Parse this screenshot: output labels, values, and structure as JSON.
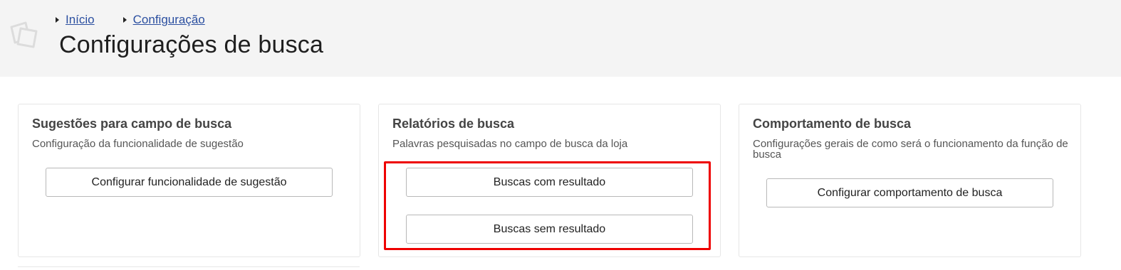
{
  "breadcrumb": {
    "items": [
      {
        "label": "Início"
      },
      {
        "label": "Configuração"
      }
    ]
  },
  "header": {
    "title": "Configurações de busca",
    "icon": "search-config-icon"
  },
  "cards": [
    {
      "title": "Sugestões para campo de busca",
      "description": "Configuração da funcionalidade de sugestão",
      "buttons": [
        "Configurar funcionalidade de sugestão"
      ]
    },
    {
      "title": "Relatórios de busca",
      "description": "Palavras pesquisadas no campo de busca da loja",
      "buttons": [
        "Buscas com resultado",
        "Buscas sem resultado"
      ]
    },
    {
      "title": "Comportamento de busca",
      "description": "Configurações gerais de como será o funcionamento da função de busca",
      "buttons": [
        "Configurar comportamento de busca"
      ]
    }
  ],
  "colors": {
    "header_bg": "#f4f4f4",
    "link": "#2b4fa0",
    "highlight": "#ee0000",
    "card_border": "#e6e6e6"
  }
}
